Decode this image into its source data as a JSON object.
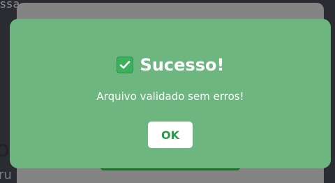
{
  "background": {
    "top_text": "ssa  ·  ·  ·    ·  ·  ·  ·  ·  ·  ·  ·",
    "left_letter": "o",
    "left_text": "ru"
  },
  "modal": {
    "title": "Sucesso!",
    "message": "Arquivo validado sem erros!",
    "ok_label": "OK",
    "icon": "check-box-icon",
    "background_color": "#6db680",
    "accent_color": "#2c9a45"
  }
}
